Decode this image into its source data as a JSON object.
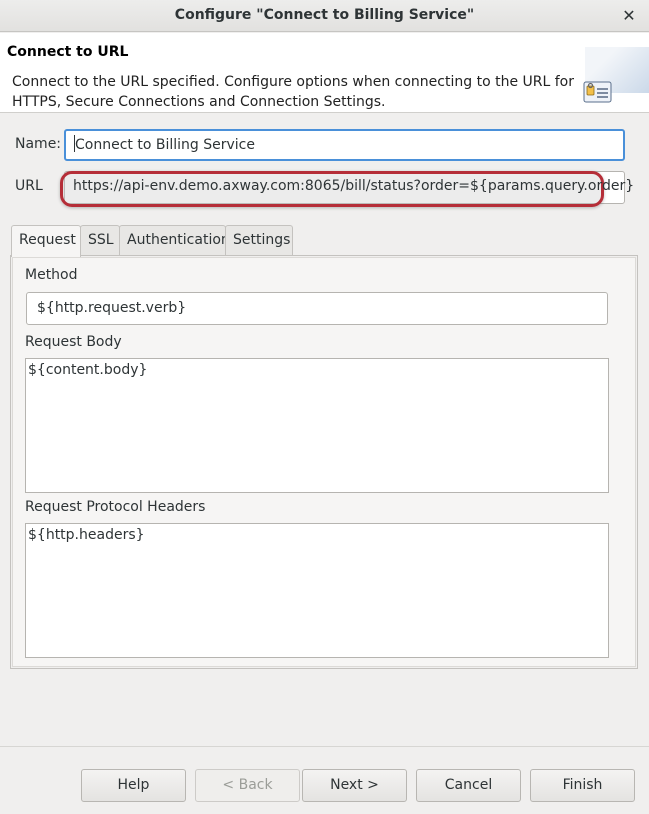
{
  "window": {
    "title": "Configure \"Connect to Billing Service\"",
    "close_glyph": "✕"
  },
  "header": {
    "title": "Connect to URL",
    "description": "Connect to the URL specified.  Configure options when connecting to the URL for HTTPS, Secure Connections and Connection Settings.",
    "icon": "filter-properties-icon"
  },
  "form": {
    "name_label": "Name:",
    "name_value": "Connect to Billing Service",
    "url_label": "URL",
    "url_value": "https://api-env.demo.axway.com:8065/bill/status?order=${params.query.order}"
  },
  "tabs": [
    {
      "label": "Request",
      "active": true
    },
    {
      "label": "SSL",
      "active": false
    },
    {
      "label": "Authentication",
      "active": false
    },
    {
      "label": "Settings",
      "active": false
    }
  ],
  "request": {
    "method_label": "Method",
    "method_value": "${http.request.verb}",
    "body_label": "Request Body",
    "body_value": "${content.body}",
    "headers_label": "Request Protocol Headers",
    "headers_value": "${http.headers}"
  },
  "buttons": {
    "help": "Help",
    "back": "< Back",
    "next": "Next >",
    "cancel": "Cancel",
    "finish": "Finish"
  },
  "colors": {
    "focus": "#4a90d9",
    "highlight": "#b52e38"
  }
}
